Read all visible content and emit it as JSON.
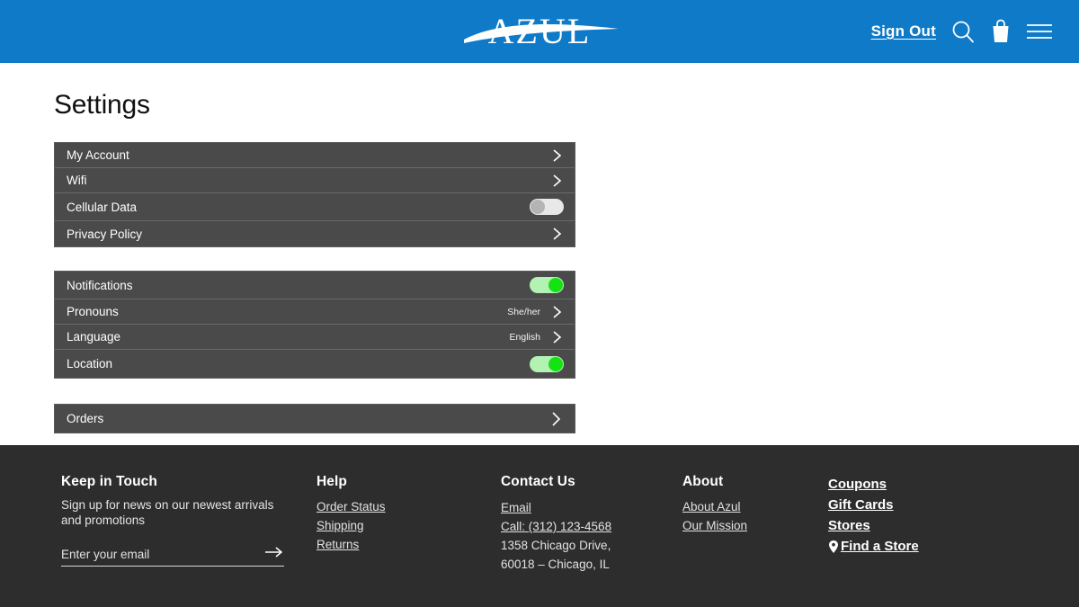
{
  "header": {
    "brand": "AZUL",
    "sign_out_label": "Sign Out",
    "icons": [
      "search-icon",
      "shopping-bag-icon",
      "hamburger-menu-icon"
    ],
    "background_color": "#0f7ac7"
  },
  "main": {
    "page_title": "Settings",
    "groups": [
      {
        "rows": [
          {
            "label": "My Account",
            "control": "chevron"
          },
          {
            "label": "Wifi",
            "control": "chevron"
          },
          {
            "label": "Cellular Data",
            "control": "toggle",
            "state": "off"
          },
          {
            "label": "Privacy Policy",
            "control": "chevron"
          }
        ]
      },
      {
        "rows": [
          {
            "label": "Notifications",
            "control": "toggle",
            "state": "on"
          },
          {
            "label": "Pronouns",
            "control": "chevron",
            "value": "She/her"
          },
          {
            "label": "Language",
            "control": "chevron",
            "value": "English"
          },
          {
            "label": "Location",
            "control": "toggle",
            "state": "on"
          }
        ]
      },
      {
        "rows": [
          {
            "label": "Orders",
            "control": "chevron"
          }
        ]
      }
    ],
    "toggle_on_color": "#14e214",
    "toggle_off_color": "#b4b4b4",
    "row_background": "#4a4a4a"
  },
  "footer": {
    "background_color": "#2d2d2d",
    "keep_in_touch": {
      "heading": "Keep in Touch",
      "description": "Sign up for news on our newest arrivals and promotions",
      "email_placeholder": "Enter your email",
      "email_value": "",
      "submit_icon": "arrow-right-icon"
    },
    "help": {
      "heading": "Help",
      "links": [
        "Order Status",
        "Shipping",
        "Returns"
      ]
    },
    "contact": {
      "heading": "Contact Us",
      "links": [
        "Email",
        "Call: (312) 123-4568"
      ],
      "address_line1": "1358 Chicago Drive,",
      "address_line2": "60018 – Chicago, IL"
    },
    "about": {
      "heading": "About",
      "links": [
        "About Azul",
        "Our Mission"
      ]
    },
    "quick_links": {
      "links": [
        "Coupons",
        "Gift Cards",
        "Stores"
      ],
      "find_store_label": "Find a Store",
      "find_store_icon": "location-pin-icon"
    }
  }
}
